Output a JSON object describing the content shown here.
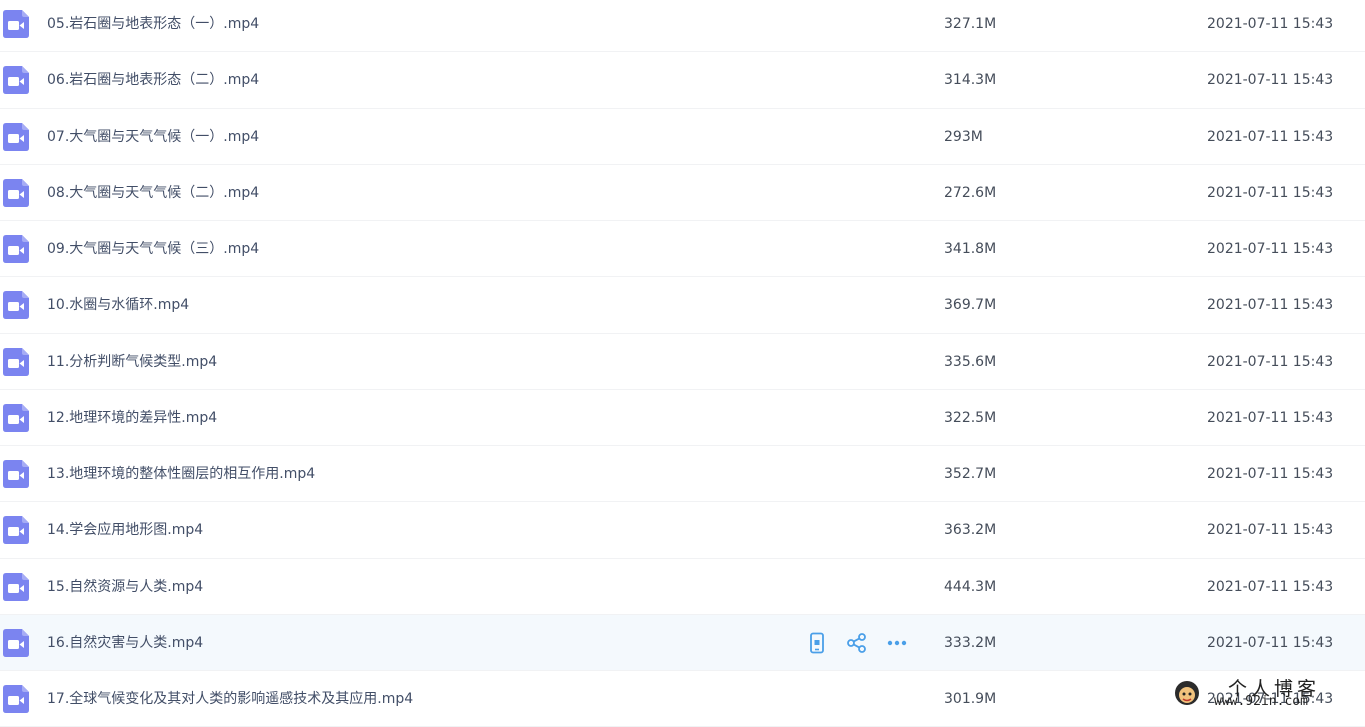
{
  "colors": {
    "file_icon": "#7b84f0",
    "action_icon": "#4a9fe8",
    "hover_row": "#f4f9fd",
    "text": "#424e67",
    "divider": "#f1f2f4"
  },
  "icons": {
    "file": "video-file-icon",
    "actions": [
      "phone-icon",
      "share-icon",
      "more-icon"
    ]
  },
  "files": [
    {
      "name": "05.岩石圈与地表形态（一）.mp4",
      "size": "327.1M",
      "date": "2021-07-11 15:43"
    },
    {
      "name": "06.岩石圈与地表形态（二）.mp4",
      "size": "314.3M",
      "date": "2021-07-11 15:43"
    },
    {
      "name": "07.大气圈与天气气候（一）.mp4",
      "size": "293M",
      "date": "2021-07-11 15:43"
    },
    {
      "name": "08.大气圈与天气气候（二）.mp4",
      "size": "272.6M",
      "date": "2021-07-11 15:43"
    },
    {
      "name": "09.大气圈与天气气候（三）.mp4",
      "size": "341.8M",
      "date": "2021-07-11 15:43"
    },
    {
      "name": "10.水圈与水循环.mp4",
      "size": "369.7M",
      "date": "2021-07-11 15:43"
    },
    {
      "name": "11.分析判断气候类型.mp4",
      "size": "335.6M",
      "date": "2021-07-11 15:43"
    },
    {
      "name": "12.地理环境的差异性.mp4",
      "size": "322.5M",
      "date": "2021-07-11 15:43"
    },
    {
      "name": "13.地理环境的整体性圈层的相互作用.mp4",
      "size": "352.7M",
      "date": "2021-07-11 15:43"
    },
    {
      "name": "14.学会应用地形图.mp4",
      "size": "363.2M",
      "date": "2021-07-11 15:43"
    },
    {
      "name": "15.自然资源与人类.mp4",
      "size": "444.3M",
      "date": "2021-07-11 15:43"
    },
    {
      "name": "16.自然灾害与人类.mp4",
      "size": "333.2M",
      "date": "2021-07-11 15:43",
      "hovered": true
    },
    {
      "name": "17.全球气候变化及其对人类的影响遥感技术及其应用.mp4",
      "size": "301.9M",
      "date": "2021-07-11 15:43"
    }
  ],
  "watermark": {
    "title": "个人博客",
    "url": "www.92in.com"
  }
}
